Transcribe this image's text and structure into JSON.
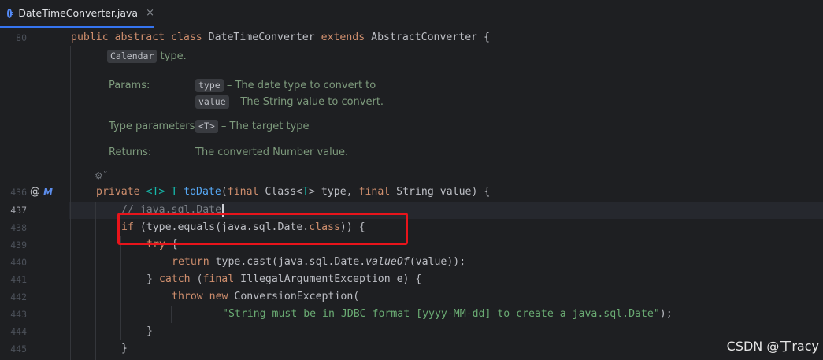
{
  "tab": {
    "label": "DateTimeConverter.java",
    "close": "×"
  },
  "gutter": {
    "line_numbers": [
      "80",
      "436",
      "437",
      "438",
      "439",
      "440",
      "441",
      "442",
      "443",
      "444",
      "445"
    ],
    "at_icon": "@",
    "impl_icon": "M"
  },
  "code": {
    "l80": {
      "kw1": "public abstract class ",
      "cls": "DateTimeConverter ",
      "kw2": "extends ",
      "cls2": "AbstractConverter {"
    },
    "l436": {
      "kw1": "private ",
      "tp1": "<T> T ",
      "fn": "toDate",
      "p1": "(",
      "kw2": "final ",
      "c1": "Class<",
      "tp2": "T",
      "c2": "> type, ",
      "kw3": "final ",
      "c3": "String value) {"
    },
    "l437": {
      "cmt": "// java.sql.Date"
    },
    "l438": {
      "kw1": "if ",
      "t1": "(type.equals(java.sql.Date.",
      "kw2": "class",
      "t2": ")) {"
    },
    "l439": {
      "kw1": "try ",
      "t1": "{"
    },
    "l440": {
      "kw1": "return ",
      "t1": "type.cast(java.sql.Date.",
      "it": "valueOf",
      "t2": "(value));"
    },
    "l441": {
      "t1": "} ",
      "kw1": "catch ",
      "t2": "(",
      "kw2": "final ",
      "t3": "IllegalArgumentException e) {"
    },
    "l442": {
      "kw1": "throw new ",
      "t1": "ConversionException("
    },
    "l443": {
      "str": "\"String must be in JDBC format [yyyy-MM-dd] to create a java.sql.Date\"",
      "t1": ");"
    },
    "l444": {
      "t1": "}"
    },
    "l445": {
      "t1": "}"
    }
  },
  "doc": {
    "calendar_chip": "Calendar",
    "calendar_text": " type.",
    "params_label": "Params:",
    "param1_chip": "type",
    "param1_text": " – The date type to convert to",
    "param2_chip": "value",
    "param2_text": " – The String value to convert.",
    "type_params_label": "Type parameters:",
    "tp_chip": "<T>",
    "tp_text": " – The target type",
    "returns_label": "Returns:",
    "returns_text": "The converted Number value.",
    "fold_icon": "⚙˅"
  },
  "watermark": "CSDN @丁racy",
  "colors": {
    "background": "#1e1f22",
    "keyword": "#cf8e6d",
    "function": "#56a8f5",
    "type_param": "#16baac",
    "string": "#6aab73",
    "highlight": "#e8141b"
  }
}
